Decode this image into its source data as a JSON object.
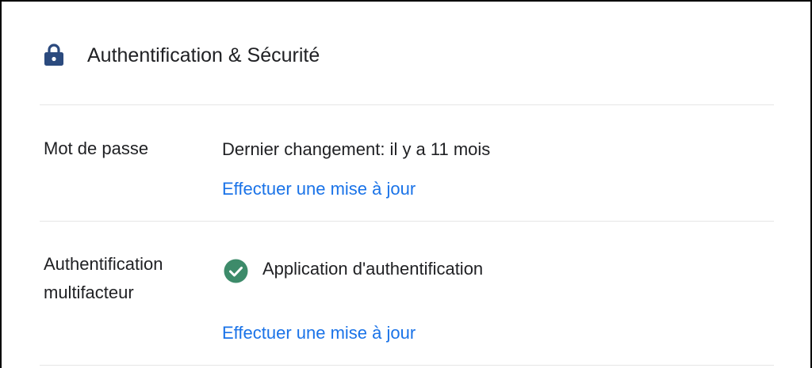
{
  "section": {
    "icon": "lock-icon",
    "title": "Authentification & Sécurité",
    "accent_color": "#2b4a7e"
  },
  "password": {
    "label": "Mot de passe",
    "status": "Dernier changement: il y a 11 mois",
    "update_link": "Effectuer une mise à jour"
  },
  "mfa": {
    "label_line1": "Authentification",
    "label_line2": "multifacteur",
    "status_icon": "check-circle-icon",
    "status_color": "#3d8b6a",
    "status": "Application d'authentification",
    "update_link": "Effectuer une mise à jour"
  },
  "colors": {
    "link": "#1a73e8",
    "text": "#202124",
    "divider": "#e6e6e6"
  }
}
